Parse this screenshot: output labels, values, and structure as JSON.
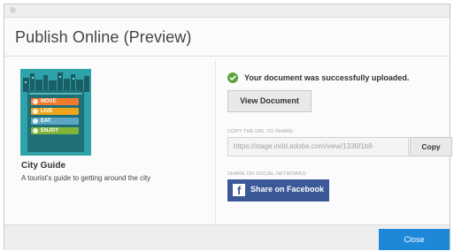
{
  "dialog": {
    "title": "Publish Online (Preview)"
  },
  "publication": {
    "thumbnail_tags": [
      {
        "label": "MOVE",
        "color": "#f2792e"
      },
      {
        "label": "LIVE",
        "color": "#f0a41c"
      },
      {
        "label": "EAT",
        "color": "#5ea6c6"
      },
      {
        "label": "ENJOY",
        "color": "#7fb539"
      }
    ],
    "title": "City Guide",
    "description": "A tourist's guide to getting around the city"
  },
  "upload": {
    "status_icon": "check-circle-icon",
    "status_color": "#5aa43b",
    "status_text": "Your document was successfully uploaded.",
    "view_button_label": "View Document"
  },
  "share_url": {
    "label": "COPY THE URL TO SHARE:",
    "value": "https://stage.indd.adobe.com/view/1336f1b8-",
    "copy_button_label": "Copy"
  },
  "social": {
    "label": "SHARE ON SOCIAL NETWORKS:",
    "facebook_icon": "facebook-icon",
    "facebook_color": "#3b5998",
    "facebook_button_label": "Share on Facebook"
  },
  "footer": {
    "close_button_label": "Close",
    "close_button_color": "#1e88d8"
  }
}
